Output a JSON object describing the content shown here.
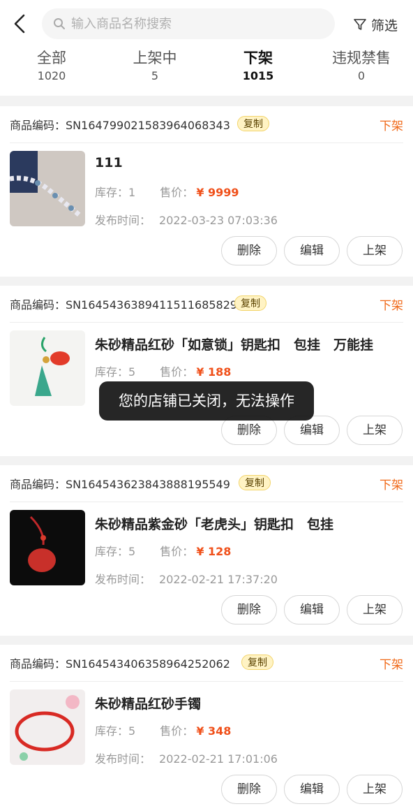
{
  "search": {
    "placeholder": "输入商品名称搜索"
  },
  "filter_label": "筛选",
  "tabs": [
    {
      "label": "全部",
      "count": "1020"
    },
    {
      "label": "上架中",
      "count": "5"
    },
    {
      "label": "下架",
      "count": "1015"
    },
    {
      "label": "违规禁售",
      "count": "0"
    }
  ],
  "labels": {
    "sku": "商品编码：",
    "copy": "复制",
    "stock": "库存：",
    "price": "售价：",
    "date": "发布时间：",
    "delete": "删除",
    "edit": "编辑",
    "shelve": "上架"
  },
  "products": [
    {
      "sku": "SN1647990215839640683​43",
      "status": "下架",
      "title": "111",
      "stock": "1",
      "price": "¥ 9999",
      "date": "2022-03-23 07:03:36"
    },
    {
      "sku": "SN164543638941151168​5829",
      "status": "下架",
      "title": "朱砂精品红砂「如意锁」钥匙扣　包挂　万能挂",
      "stock": "5",
      "price": "¥ 188",
      "date": ""
    },
    {
      "sku": "SN164543623843888195549",
      "status": "下架",
      "title": "朱砂精品紫金砂「老虎头」钥匙扣　包挂",
      "stock": "5",
      "price": "¥ 128",
      "date": "2022-02-21 17:37:20"
    },
    {
      "sku": "SN164543406358964252062",
      "status": "下架",
      "title": "朱砂精品红砂手镯",
      "stock": "5",
      "price": "¥ 348",
      "date": "2022-02-21 17:01:06"
    }
  ],
  "toast": "您的店铺已关闭，无法操作",
  "colors": {
    "accent": "#f06a1a",
    "price": "#f0501a",
    "badge_bg": "#fff3c4"
  }
}
